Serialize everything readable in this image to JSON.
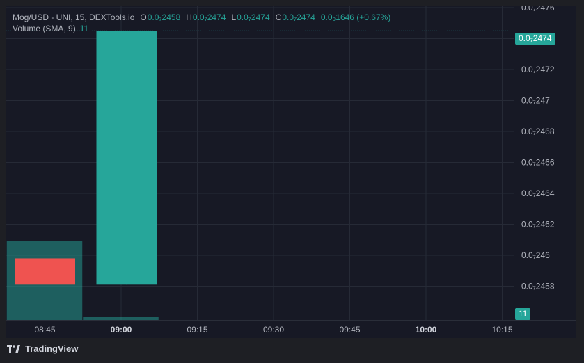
{
  "legend": {
    "title": "Mog/USD - UNI, 15, DEXTools.io",
    "o_key": "O",
    "o_val": "0.0₇2458",
    "h_key": "H",
    "h_val": "0.0₇2474",
    "l_key": "L",
    "l_val": "0.0₇2474",
    "c_key": "C",
    "c_val": "0.0₇2474",
    "change": "0.0₉1646 (+0.67%)",
    "volume_label": "Volume (SMA, 9)",
    "volume_value": "11"
  },
  "price_badge": "0.0₇2474",
  "volume_badge": "11",
  "brand": "TradingView",
  "colors": {
    "up": "#26a69a",
    "down": "#ef5350",
    "bg": "#171925",
    "grid": "#262a36"
  },
  "chart_data": {
    "type": "candlestick",
    "price_ticks": [
      "0.0₇2476",
      "0.0₇2474",
      "0.0₇2472",
      "0.0₇247",
      "0.0₇2468",
      "0.0₇2466",
      "0.0₇2464",
      "0.0₇2462",
      "0.0₇246",
      "0.0₇2458"
    ],
    "price_tick_values": [
      2476,
      2474,
      2472,
      2470,
      2468,
      2466,
      2464,
      2462,
      2460,
      2458
    ],
    "time_ticks": [
      {
        "label": "08:45",
        "bold": false
      },
      {
        "label": "09:00",
        "bold": true
      },
      {
        "label": "09:15",
        "bold": false
      },
      {
        "label": "09:30",
        "bold": false
      },
      {
        "label": "09:45",
        "bold": false
      },
      {
        "label": "10:00",
        "bold": true
      },
      {
        "label": "10:15",
        "bold": false
      }
    ],
    "candles": [
      {
        "time": "08:45",
        "open": 2459.8,
        "high": 2474.0,
        "low": 2458.0,
        "close": 2458.1,
        "volume": 11,
        "direction": "down"
      },
      {
        "time": "09:00",
        "open": 2458.1,
        "high": 2474.5,
        "low": 2458.1,
        "close": 2474.5,
        "volume": 0.3,
        "direction": "up"
      }
    ],
    "current_price": 2474.5,
    "y_range": [
      2457.0,
      2477.0
    ]
  }
}
